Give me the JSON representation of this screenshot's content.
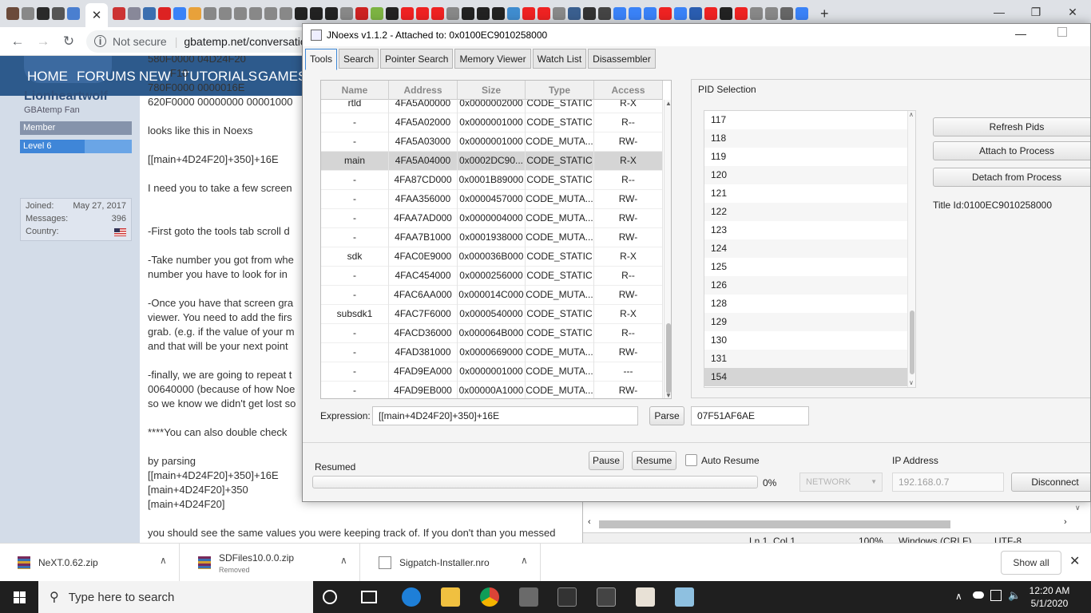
{
  "browser": {
    "address_prefix": "Not secure",
    "address_url": "gbatemp.net/conversatio",
    "new_tab": "+",
    "close_tab": "✕",
    "favicon_colors": [
      "#6b4a3a",
      "#888",
      "#2a2a2a",
      "#555",
      "#4a7fd0",
      "#c33",
      "#889",
      "#3b6fb0",
      "#d22",
      "#3a82f7",
      "#e8a13a",
      "#888",
      "#888",
      "#888",
      "#888",
      "#888",
      "#888",
      "#222",
      "#222",
      "#222",
      "#888",
      "#c22",
      "#7cb342",
      "#222",
      "#e22",
      "#e22",
      "#e22",
      "#888",
      "#222",
      "#222",
      "#222",
      "#3f8ccf",
      "#e22",
      "#e22",
      "#888",
      "#3a5f8f",
      "#333",
      "#444",
      "#3a82f7",
      "#3a82f7",
      "#3a82f7",
      "#e22",
      "#3a82f7",
      "#2a5db0",
      "#e22",
      "#222",
      "#e22",
      "#888",
      "#888",
      "#666",
      "#3a82f7"
    ]
  },
  "website": {
    "nav": [
      "HOME",
      "FORUMS",
      "NEW",
      "TUTORIALS",
      "GAMES"
    ],
    "profile": {
      "username": "Lionheartwolf",
      "user_title": "GBAtemp Fan",
      "rank": "Member",
      "level": "Level 6",
      "stats": [
        {
          "label": "Joined:",
          "value": "May 27, 2017"
        },
        {
          "label": "Messages:",
          "value": "396"
        },
        {
          "label": "Country:",
          "value": ""
        }
      ]
    },
    "post_lines": [
      "580F0000 04D24F20",
      "F10",
      "780F0000 0000016E",
      "620F0000 00000000 00001000",
      "looks like this in Noexs",
      "[[main+4D24F20]+350]+16E",
      "I need you to take a few screen",
      "-First goto the tools tab scroll d",
      "-Take number you got from whe",
      "number you have to look for in",
      "-Once you have that screen gra",
      "viewer. You need to add the firs",
      "grab. (e.g. if the value of your m",
      "and that will be your next point",
      "-finally, we are going to repeat t",
      "00640000 (because of how Noe",
      "so we know we didn't get lost so",
      "****You can also double check",
      "by parsing",
      "[[main+4D24F20]+350]+16E",
      "[main+4D24F20]+350",
      "[main+4D24F20]",
      "you should see the same values you were keeping track of. If you don't than you messed"
    ]
  },
  "notepad": {
    "position": "Ln 1, Col 1",
    "zoom": "100%",
    "line_ending": "Windows (CRLF)",
    "encoding": "UTF-8"
  },
  "downloads": [
    {
      "name": "NeXT.0.62.zip",
      "sub": "",
      "icon_color": "#a33"
    },
    {
      "name": "SDFiles10.0.0.zip",
      "sub": "Removed",
      "icon_color": "#a33"
    },
    {
      "name": "Sigpatch-Installer.nro",
      "sub": "",
      "icon_color": "#ddd"
    }
  ],
  "downloads_show_all": "Show all",
  "taskbar": {
    "search_placeholder": "Type here to search",
    "time": "12:20 AM",
    "date": "5/1/2020"
  },
  "jnoexs": {
    "title": "JNoexs v1.1.2 - Attached to: 0x0100EC9010258000",
    "tabs": [
      "Tools",
      "Search",
      "Pointer Search",
      "Memory Viewer",
      "Watch List",
      "Disassembler"
    ],
    "active_tab": "Tools",
    "memory_columns": [
      "Name",
      "Address",
      "Size",
      "Type",
      "Access"
    ],
    "memory_rows": [
      [
        "rtld",
        "4FA5A00000",
        "0x0000002000",
        "CODE_STATIC",
        "R-X"
      ],
      [
        "-",
        "4FA5A02000",
        "0x0000001000",
        "CODE_STATIC",
        "R--"
      ],
      [
        "-",
        "4FA5A03000",
        "0x0000001000",
        "CODE_MUTA...",
        "RW-"
      ],
      [
        "main",
        "4FA5A04000",
        "0x0002DC90...",
        "CODE_STATIC",
        "R-X"
      ],
      [
        "-",
        "4FA87CD000",
        "0x0001B89000",
        "CODE_STATIC",
        "R--"
      ],
      [
        "-",
        "4FAA356000",
        "0x0000457000",
        "CODE_MUTA...",
        "RW-"
      ],
      [
        "-",
        "4FAA7AD000",
        "0x0000004000",
        "CODE_MUTA...",
        "RW-"
      ],
      [
        "-",
        "4FAA7B1000",
        "0x0001938000",
        "CODE_MUTA...",
        "RW-"
      ],
      [
        "sdk",
        "4FAC0E9000",
        "0x000036B000",
        "CODE_STATIC",
        "R-X"
      ],
      [
        "-",
        "4FAC454000",
        "0x0000256000",
        "CODE_STATIC",
        "R--"
      ],
      [
        "-",
        "4FAC6AA000",
        "0x000014C000",
        "CODE_MUTA...",
        "RW-"
      ],
      [
        "subsdk1",
        "4FAC7F6000",
        "0x0000540000",
        "CODE_STATIC",
        "R-X"
      ],
      [
        "-",
        "4FACD36000",
        "0x000064B000",
        "CODE_STATIC",
        "R--"
      ],
      [
        "-",
        "4FAD381000",
        "0x0000669000",
        "CODE_MUTA...",
        "RW-"
      ],
      [
        "-",
        "4FAD9EA000",
        "0x0000001000",
        "CODE_MUTA...",
        "---"
      ],
      [
        "-",
        "4FAD9EB000",
        "0x00000A1000",
        "CODE_MUTA...",
        "RW-"
      ]
    ],
    "selected_memory_row": 3,
    "pid_panel_title": "PID Selection",
    "pids": [
      "117",
      "118",
      "119",
      "120",
      "121",
      "122",
      "123",
      "124",
      "125",
      "126",
      "128",
      "129",
      "130",
      "131",
      "154"
    ],
    "selected_pid": "154",
    "refresh_pids": "Refresh Pids",
    "attach": "Attach to Process",
    "detach": "Detach from Process",
    "title_id": "Title Id:0100EC9010258000",
    "expression_label": "Expression:",
    "expression_value": "[[main+4D24F20]+350]+16E",
    "parse": "Parse",
    "result_value": "07F51AF6AE",
    "status": "Resumed",
    "progress_percent": "0%",
    "pause": "Pause",
    "resume": "Resume",
    "auto_resume": "Auto Resume",
    "network": "NETWORK",
    "ip_label": "IP Address",
    "ip_value": "192.168.0.7",
    "disconnect": "Disconnect"
  }
}
